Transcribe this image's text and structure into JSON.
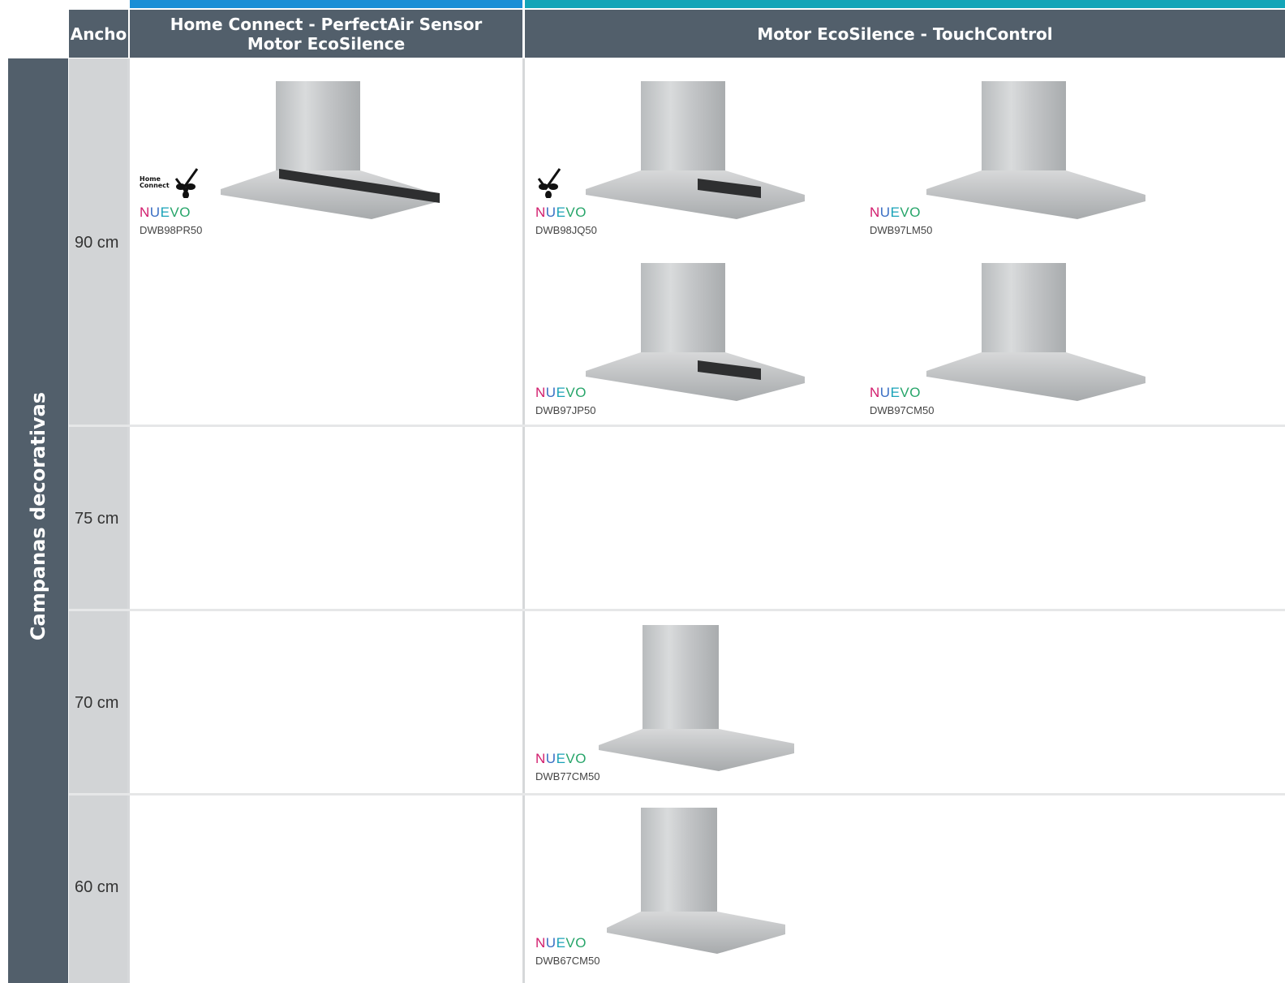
{
  "header": {
    "width_label": "Ancho",
    "col1_line1": "Home Connect - PerfectAir Sensor",
    "col1_line2": "Motor EcoSilence",
    "col2": "Motor EcoSilence - TouchControl"
  },
  "section_label": "Campanas decorativas",
  "widths": [
    "90 cm",
    "75 cm",
    "70 cm",
    "60 cm"
  ],
  "new_label": [
    "N",
    "U",
    "E",
    "V",
    "O"
  ],
  "products": [
    {
      "model": "DWB98PR50",
      "new": true,
      "icons": [
        "home-connect-icon",
        "perfectair-sensor-icon"
      ],
      "home_connect_text": "Home Connect"
    },
    {
      "model": "DWB98JQ50",
      "new": true,
      "icons": [
        "perfectair-sensor-icon"
      ]
    },
    {
      "model": "DWB97LM50",
      "new": true,
      "icons": []
    },
    {
      "model": "DWB97JP50",
      "new": true,
      "icons": []
    },
    {
      "model": "DWB97CM50",
      "new": true,
      "icons": []
    },
    {
      "model": "DWB77CM50",
      "new": true,
      "icons": []
    },
    {
      "model": "DWB67CM50",
      "new": true,
      "icons": []
    }
  ],
  "colors": {
    "header_bg": "#525f6b",
    "bar_blue": "#1a8fd6",
    "bar_teal": "#13a5b8",
    "width_col_bg": "#d2d4d6"
  }
}
